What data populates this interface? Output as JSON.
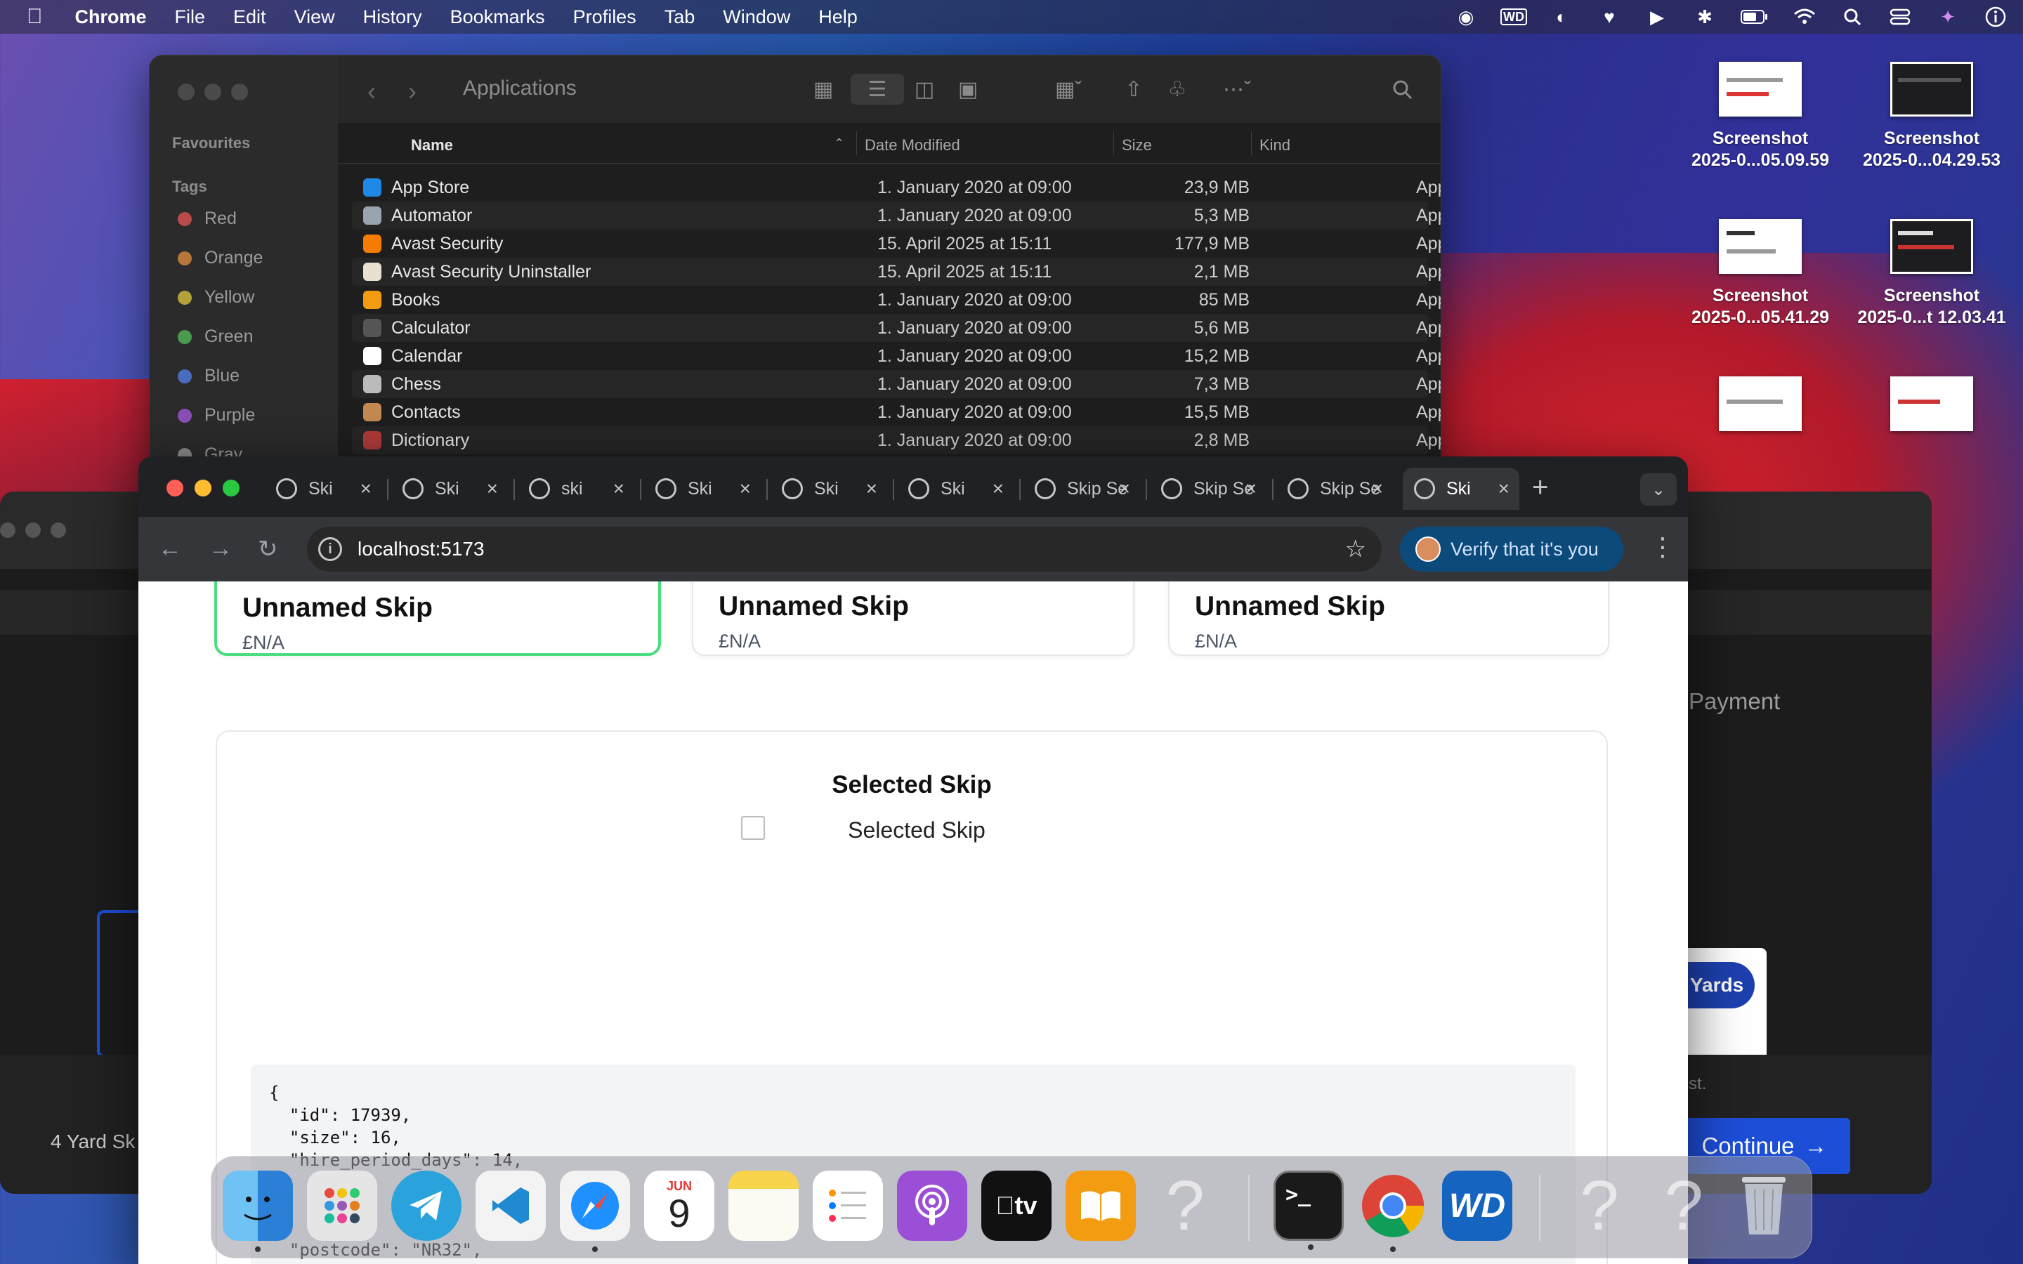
{
  "menubar": {
    "app": "Chrome",
    "items": [
      "File",
      "Edit",
      "View",
      "History",
      "Bookmarks",
      "Profiles",
      "Tab",
      "Window",
      "Help"
    ]
  },
  "desktop": {
    "icons": [
      {
        "line1": "Screenshot",
        "line2": "2025-0...05.09.59"
      },
      {
        "line1": "Screenshot",
        "line2": "2025-0...04.29.53"
      },
      {
        "line1": "Screenshot",
        "line2": "2025-0...05.41.29"
      },
      {
        "line1": "Screenshot",
        "line2": "2025-0...t 12.03.41"
      }
    ]
  },
  "finder": {
    "title": "Applications",
    "sidebar": {
      "favourites": "Favourites",
      "tags_heading": "Tags",
      "tags": [
        {
          "label": "Red",
          "color": "#b94a4a"
        },
        {
          "label": "Orange",
          "color": "#b7773a"
        },
        {
          "label": "Yellow",
          "color": "#b5a23a"
        },
        {
          "label": "Green",
          "color": "#4a9a4f"
        },
        {
          "label": "Blue",
          "color": "#4a6cbf"
        },
        {
          "label": "Purple",
          "color": "#8a4fb5"
        },
        {
          "label": "Gray",
          "color": "#8a8a8a"
        }
      ]
    },
    "columns": {
      "name": "Name",
      "date": "Date Modified",
      "size": "Size",
      "kind": "Kind"
    },
    "rows": [
      {
        "name": "App Store",
        "date": "1. January 2020 at 09:00",
        "size": "23,9 MB",
        "kind": "Application",
        "color": "#1e88e5"
      },
      {
        "name": "Automator",
        "date": "1. January 2020 at 09:00",
        "size": "5,3 MB",
        "kind": "Application",
        "color": "#9aa4b0"
      },
      {
        "name": "Avast Security",
        "date": "15. April 2025 at 15:11",
        "size": "177,9 MB",
        "kind": "Application",
        "color": "#f57c00"
      },
      {
        "name": "Avast Security Uninstaller",
        "date": "15. April 2025 at 15:11",
        "size": "2,1 MB",
        "kind": "Application",
        "color": "#e8e0d0"
      },
      {
        "name": "Books",
        "date": "1. January 2020 at 09:00",
        "size": "85 MB",
        "kind": "Application",
        "color": "#f39c12"
      },
      {
        "name": "Calculator",
        "date": "1. January 2020 at 09:00",
        "size": "5,6 MB",
        "kind": "Application",
        "color": "#555555"
      },
      {
        "name": "Calendar",
        "date": "1. January 2020 at 09:00",
        "size": "15,2 MB",
        "kind": "Application",
        "color": "#ffffff"
      },
      {
        "name": "Chess",
        "date": "1. January 2020 at 09:00",
        "size": "7,3 MB",
        "kind": "Application",
        "color": "#bbbbbb"
      },
      {
        "name": "Contacts",
        "date": "1. January 2020 at 09:00",
        "size": "15,5 MB",
        "kind": "Application",
        "color": "#c48a52"
      },
      {
        "name": "Dictionary",
        "date": "1. January 2020 at 09:00",
        "size": "2,8 MB",
        "kind": "Application",
        "color": "#b03a3a"
      }
    ]
  },
  "backwin": {
    "payment": "Payment",
    "yards": "Yards",
    "continue": "Continue",
    "partial": "st.",
    "skip_label": "4 Yard Sk"
  },
  "chrome": {
    "tabs": [
      {
        "label": "Ski"
      },
      {
        "label": "Ski"
      },
      {
        "label": "ski"
      },
      {
        "label": "Ski"
      },
      {
        "label": "Ski"
      },
      {
        "label": "Ski"
      },
      {
        "label": "Skip Se"
      },
      {
        "label": "Skip Se"
      },
      {
        "label": "Skip Se"
      },
      {
        "label": "Ski"
      }
    ],
    "url": "localhost:5173",
    "verify": "Verify that it's you"
  },
  "page": {
    "cards": [
      {
        "title": "Unnamed Skip",
        "price": "£N/A"
      },
      {
        "title": "Unnamed Skip",
        "price": "£N/A"
      },
      {
        "title": "Unnamed Skip",
        "price": "£N/A"
      }
    ],
    "selected_title": "Selected Skip",
    "image_alt": "Selected Skip",
    "json_text": "{\n  \"id\": 17939,\n  \"size\": 16,\n  \"hire_period_days\": 14,\n\n\n\n  \"postcode\": \"NR32\","
  },
  "dock": {
    "calendar_month": "JUN",
    "calendar_day": "9"
  }
}
